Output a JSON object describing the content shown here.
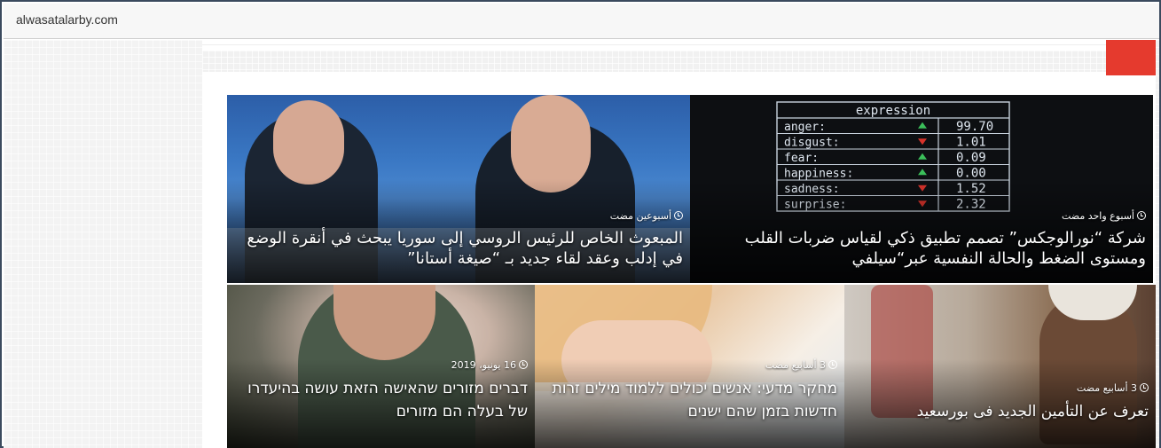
{
  "browser": {
    "url": "alwasatalarby.com"
  },
  "cards": [
    {
      "time": "أسبوعين مضت",
      "title": "المبعوث الخاص للرئيس الروسي إلى سوريا يبحث في أنقرة الوضع في إدلب وعقد لقاء جديد بـ “صيغة أستانا”"
    },
    {
      "time": "أسبوع واحد مضت",
      "title": "شركة “نورالوجكس” تصمم تطبيق ذكي لقياس ضربات القلب ومستوى الضغط والحالة النفسية عبر“سيلفي"
    },
    {
      "time": "16 يونيو، 2019",
      "title": "דברים מזורים שהאישה הזאת עושה בהיעדרו של בעלה הם מזורים"
    },
    {
      "time": "3 أسابيع مضت",
      "title": "מחקר מדעי: אנשים יכולים ללמוד מילים זרות חדשות בזמן שהם ישנים"
    },
    {
      "time": "3 أسابيع مضت",
      "title": "تعرف عن التأمين الجديد فى بورسعيد"
    }
  ],
  "expression_table": {
    "header": "expression",
    "rows": [
      {
        "label": "anger:",
        "value": "99.70",
        "dir": "up"
      },
      {
        "label": "disgust:",
        "value": "1.01",
        "dir": "down"
      },
      {
        "label": "fear:",
        "value": "0.09",
        "dir": "up"
      },
      {
        "label": "happiness:",
        "value": "0.00",
        "dir": "up"
      },
      {
        "label": "sadness:",
        "value": "1.52",
        "dir": "down"
      },
      {
        "label": "surprise:",
        "value": "2.32",
        "dir": "down"
      }
    ]
  },
  "colors": {
    "accent": "#e53a2e",
    "frame": "#3b4a5e"
  },
  "icons": [
    "clock-icon"
  ]
}
